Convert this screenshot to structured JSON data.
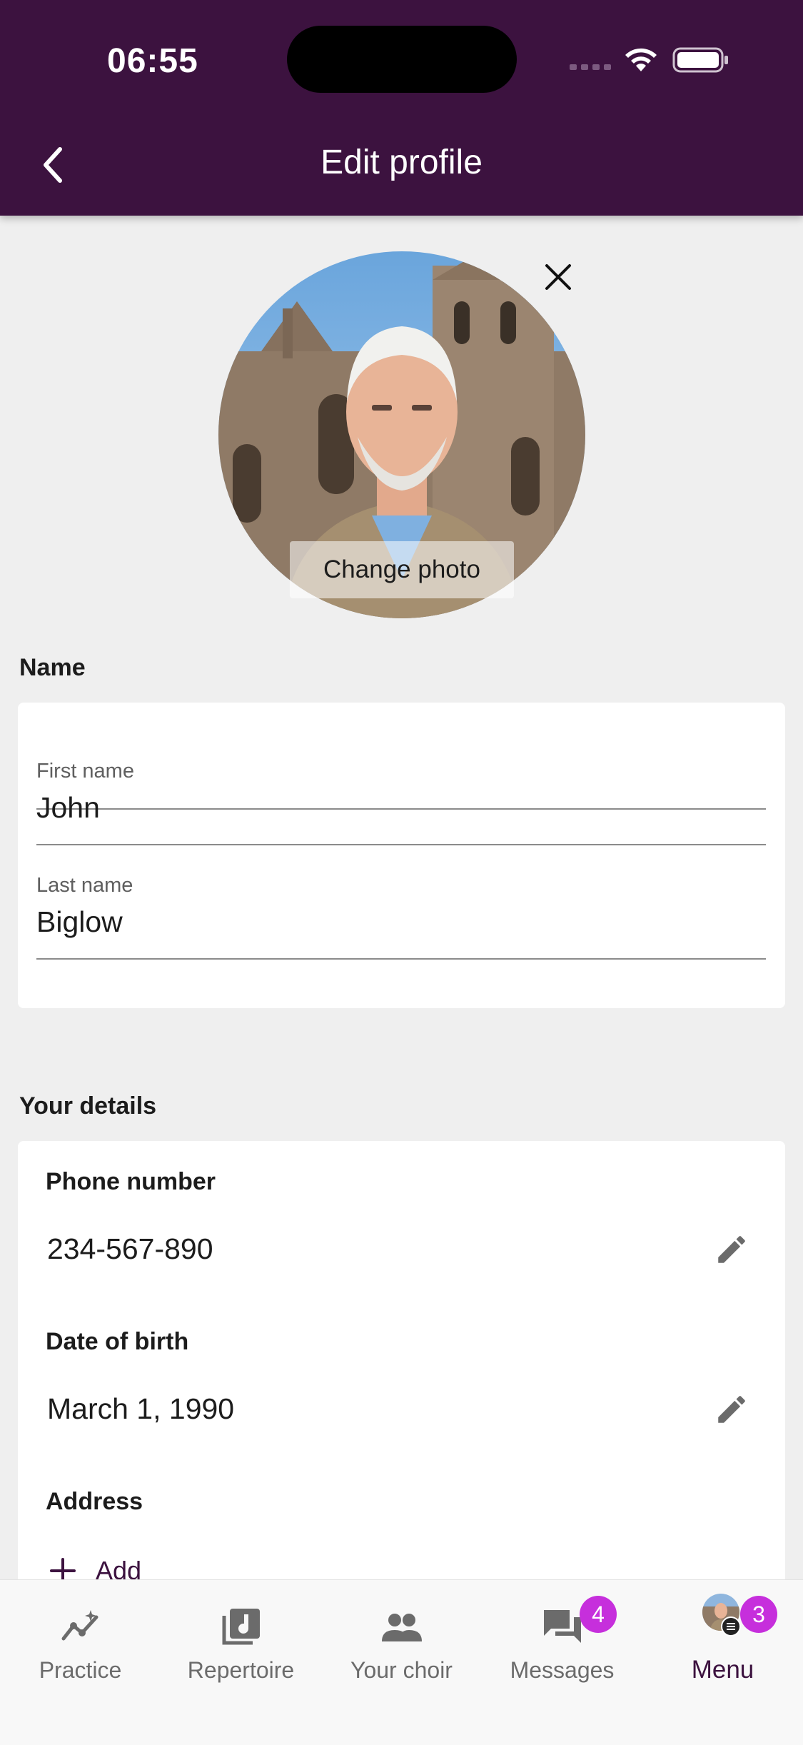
{
  "status_bar": {
    "time": "06:55"
  },
  "header": {
    "title": "Edit profile"
  },
  "photo": {
    "change_label": "Change photo"
  },
  "name_section": {
    "label": "Name",
    "first_name": {
      "label": "First name",
      "value": "John"
    },
    "last_name": {
      "label": "Last name",
      "value": "Biglow"
    }
  },
  "details_section": {
    "label": "Your details",
    "phone": {
      "label": "Phone number",
      "value": "234-567-890"
    },
    "dob": {
      "label": "Date of birth",
      "value": "March 1, 1990"
    },
    "address": {
      "label": "Address",
      "add_label": "Add"
    }
  },
  "tabbar": {
    "items": [
      {
        "label": "Practice"
      },
      {
        "label": "Repertoire"
      },
      {
        "label": "Your choir"
      },
      {
        "label": "Messages",
        "badge": "4"
      },
      {
        "label": "Menu",
        "badge": "3"
      }
    ]
  },
  "colors": {
    "header": "#3c123f",
    "badge": "#c62fdc",
    "background": "#efefef"
  }
}
